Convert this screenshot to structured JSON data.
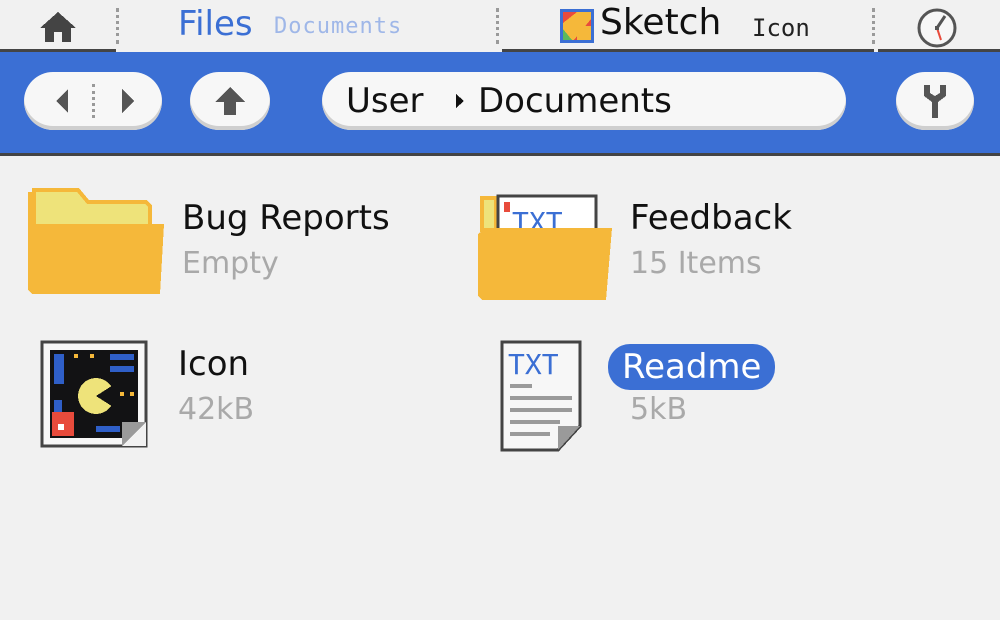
{
  "tabs": {
    "home": {
      "icon": "home-icon"
    },
    "files": {
      "title": "Files",
      "subtitle": "Documents",
      "color": "#3b6fd4"
    },
    "sketch": {
      "title": "Sketch",
      "subtitle": "Icon",
      "icon": "sketch-app-icon"
    },
    "clock": {
      "icon": "clock-icon"
    }
  },
  "toolbar": {
    "background": "#3b6fd4",
    "back_icon": "back-arrow-icon",
    "forward_icon": "forward-arrow-icon",
    "up_icon": "up-arrow-icon",
    "path": {
      "segments": [
        "User",
        "Documents"
      ],
      "separator_icon": "breadcrumb-arrow-icon"
    },
    "tools_icon": "wrench-icon"
  },
  "items": [
    {
      "name": "Bug Reports",
      "meta": "Empty",
      "icon": "folder-icon",
      "selected": false
    },
    {
      "name": "Feedback",
      "meta": "15 Items",
      "icon": "folder-with-txt-icon",
      "overlay_label": "TXT",
      "selected": false
    },
    {
      "name": "Icon",
      "meta": "42kB",
      "icon": "image-file-icon",
      "selected": false
    },
    {
      "name": "Readme",
      "meta": "5kB",
      "icon": "txt-file-icon",
      "type_label": "TXT",
      "selected": true
    }
  ]
}
